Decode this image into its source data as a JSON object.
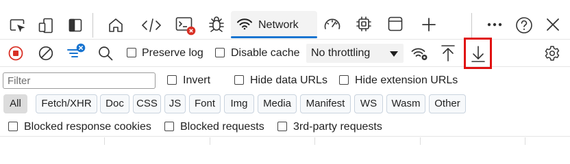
{
  "tabs": {
    "inspect_icon": "inspect-element-icon",
    "device_icon": "device-emulation-icon",
    "sidebar_icon": "dock-sidebar-icon",
    "welcome_icon": "home-icon",
    "elements_icon": "elements-code-icon",
    "console_icon": "console-icon",
    "console_error_badge": "x",
    "sources_icon": "bug-icon",
    "network": {
      "label": "Network",
      "icon": "wifi-icon"
    },
    "performance_icon": "gauge-icon",
    "memory_icon": "chip-icon",
    "application_icon": "window-icon",
    "add_icon": "plus-icon",
    "more_icon": "more-dots-icon",
    "help_icon": "help-icon",
    "close_icon": "close-icon"
  },
  "toolbar": {
    "record_icon": "record-stop-icon",
    "clear_icon": "clear-icon",
    "filter_icon": "filter-lines-icon",
    "search_icon": "search-icon",
    "preserve_log": "Preserve log",
    "disable_cache": "Disable cache",
    "throttling": "No throttling",
    "network_conditions_icon": "network-settings-icon",
    "import_icon": "upload-arrow-icon",
    "export_icon": "download-arrow-icon",
    "settings_icon": "settings-gear-icon",
    "highlight_color": "#e01010"
  },
  "filter": {
    "placeholder": "Filter",
    "invert": "Invert",
    "hide_data_urls": "Hide data URLs",
    "hide_extension_urls": "Hide extension URLs"
  },
  "types": [
    "All",
    "Fetch/XHR",
    "Doc",
    "CSS",
    "JS",
    "Font",
    "Img",
    "Media",
    "Manifest",
    "WS",
    "Wasm",
    "Other"
  ],
  "block": {
    "blocked_response_cookies": "Blocked response cookies",
    "blocked_requests": "Blocked requests",
    "third_party_requests": "3rd-party requests"
  },
  "colors": {
    "accent": "#1874d0",
    "record": "#d93025"
  }
}
